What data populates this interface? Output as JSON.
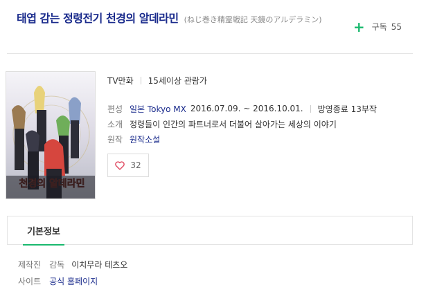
{
  "header": {
    "title": "태엽 감는 정령전기 천경의 알데라민",
    "original_title": "(ねじ巻き精霊戦記 天鏡のアルデラミン)",
    "subscribe_label": "구독",
    "subscribe_count": "55"
  },
  "info": {
    "format": "TV만화",
    "rating": "15세이상 관람가",
    "broadcast_label": "편성",
    "broadcast_value": "일본 Tokyo MX",
    "period": "2016.07.09. ~ 2016.10.01.",
    "status": "방영종료 13부작",
    "synopsis_label": "소개",
    "synopsis": "정령들이 인간의 파트너로서 더불어 살아가는 세상의 이야기",
    "original_label": "원작",
    "original_value": "원작소설",
    "like_count": "32"
  },
  "tabs": {
    "basic_info": "기본정보"
  },
  "details": {
    "production_label": "제작진",
    "director_role": "감독",
    "director_name": "이치무라 테츠오",
    "site_label": "사이트",
    "site_value": "공식 홈페이지"
  },
  "poster": {
    "caption": "천경의 알데라민"
  },
  "colors": {
    "title": "#1a2b8c",
    "accent": "#19b96e",
    "like_heart": "#e0475f"
  }
}
